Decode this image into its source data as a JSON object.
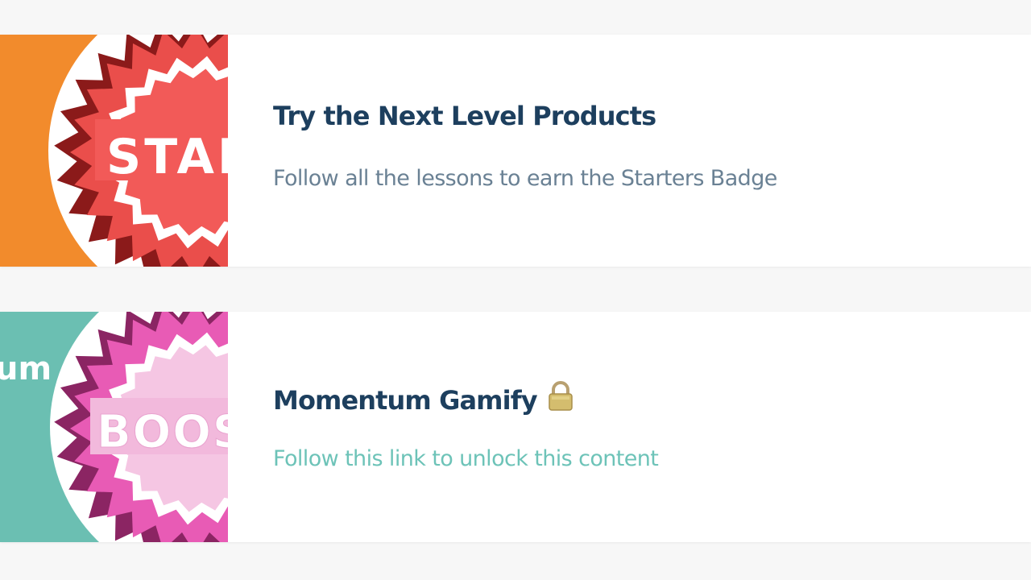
{
  "colors": {
    "page_bg": "#f7f7f7",
    "card_bg": "#ffffff",
    "title": "#1d3f5e",
    "desc": "#6a8194",
    "link": "#6dc3b8",
    "orange": "#f28b2c",
    "teal": "#6bbfb2",
    "red_badge": "#f25a58",
    "pink_badge": "#f2b9dc"
  },
  "courses": [
    {
      "title": "Try the Next Level Products",
      "description": "Follow all the lessons to earn the Starters Badge",
      "thumbnail": {
        "badge_text": "STAR",
        "badge_icon": "starters-badge-icon"
      }
    },
    {
      "title": "Momentum Gamify",
      "title_icon": "lock-icon",
      "description": "Follow this link to unlock this content",
      "locked": true,
      "thumbnail": {
        "side_text": "um",
        "badge_text": "BOOS",
        "badge_icon": "boost-badge-icon"
      }
    }
  ]
}
